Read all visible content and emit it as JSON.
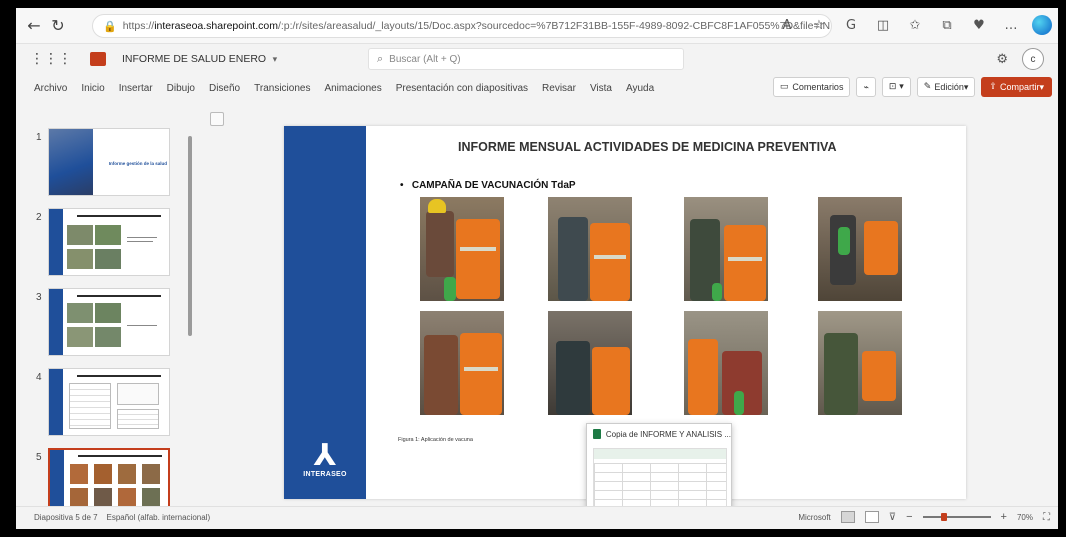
{
  "browser": {
    "url_prefix": "https://",
    "url_domain": "interaseoa.sharepoint.com",
    "url_rest": "/:p:/r/sites/areasalud/_layouts/15/Doc.aspx?sourcedoc=%7B712F31BB-155F-4989-8092-CBFC8F1AF055%7D&file=INFOR..."
  },
  "app": {
    "doc_name": "INFORME DE SALUD ENERO",
    "search_placeholder": "Buscar (Alt + Q)",
    "avatar_initial": "c"
  },
  "ribbon": {
    "tabs": [
      "Archivo",
      "Inicio",
      "Insertar",
      "Dibujo",
      "Diseño",
      "Transiciones",
      "Animaciones",
      "Presentación con diapositivas",
      "Revisar",
      "Vista",
      "Ayuda"
    ],
    "comments_label": "Comentarios",
    "editing_label": "Edición",
    "share_label": "Compartir"
  },
  "thumbnails": {
    "numbers": [
      "1",
      "2",
      "3",
      "4",
      "5"
    ],
    "slide1_title": "Informe gestión de la salud"
  },
  "slide": {
    "title": "INFORME MENSUAL ACTIVIDADES DE MEDICINA PREVENTIVA",
    "bullet": "CAMPAÑA DE VACUNACIÓN TdaP",
    "caption": "Figura 1: Aplicación de vacuna",
    "brand": "INTERASEO"
  },
  "popup": {
    "title": "Copia de INFORME Y ANALISIS ..."
  },
  "status": {
    "slide_info": "Diapositiva 5 de 7",
    "language": "Español (alfab. internacional)",
    "feedback": "Microsoft",
    "zoom": "70%",
    "zoom_fraction": 0.3
  },
  "colors": {
    "accent": "#c43e1c",
    "slide_blue": "#1f4f9a",
    "vest_orange": "#e8761f"
  }
}
